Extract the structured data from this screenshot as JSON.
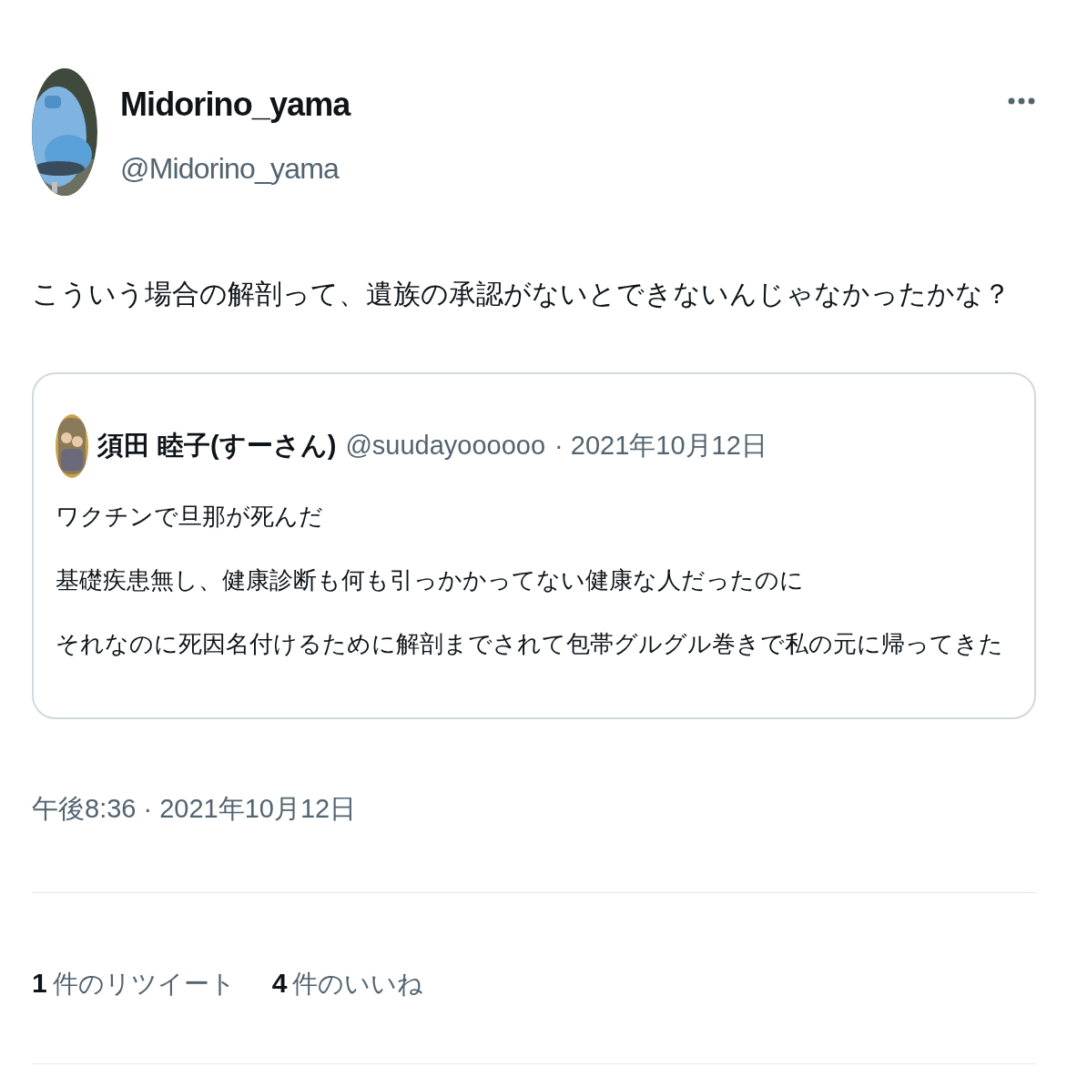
{
  "author": {
    "name": "Midorino_yama",
    "handle": "@Midorino_yama"
  },
  "body": "こういう場合の解剖って、遺族の承認がないとできないんじゃなかったかな？",
  "quote": {
    "name": "須田 睦子(すーさん)",
    "handle": "@suudayoooooo",
    "date": "· 2021年10月12日",
    "lines": [
      "ワクチンで旦那が死んだ",
      "基礎疾患無し、健康診断も何も引っかかってない健康な人だったのに",
      "それなのに死因名付けるために解剖までされて包帯グルグル巻きで私の元に帰ってきた"
    ]
  },
  "timestamp": "午後8:36 · 2021年10月12日",
  "stats": [
    {
      "count": "1",
      "label": "件のリツイート"
    },
    {
      "count": "4",
      "label": "件のいいね"
    }
  ]
}
